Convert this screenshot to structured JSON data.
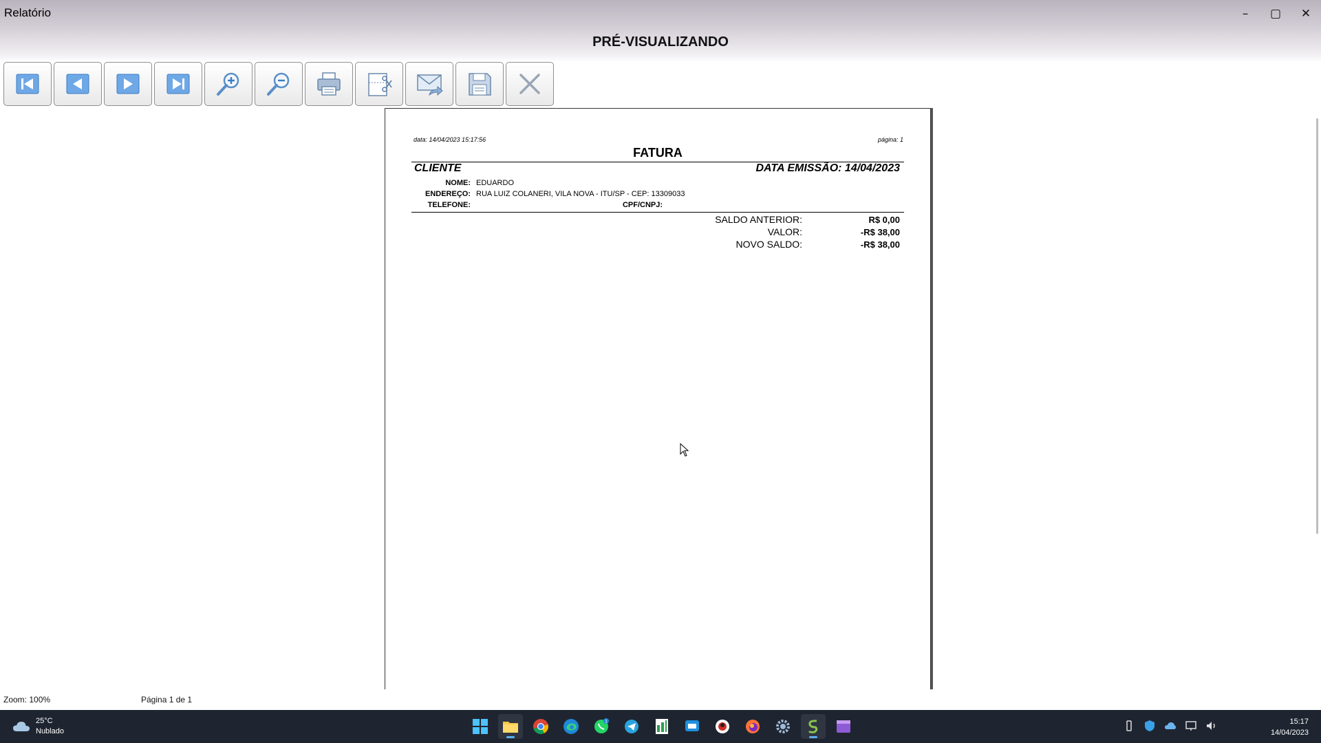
{
  "window": {
    "title": "Relatório",
    "heading": "PRÉ-VISUALIZANDO",
    "controls": {
      "minimize": "–",
      "maximize": "▢",
      "close": "✕"
    }
  },
  "toolbar": {
    "buttons": [
      {
        "name": "first-page",
        "icon": "first-page-icon"
      },
      {
        "name": "previous-page",
        "icon": "previous-page-icon"
      },
      {
        "name": "next-page",
        "icon": "next-page-icon"
      },
      {
        "name": "last-page",
        "icon": "last-page-icon"
      },
      {
        "name": "zoom-in",
        "icon": "zoom-in-icon"
      },
      {
        "name": "zoom-out",
        "icon": "zoom-out-icon"
      },
      {
        "name": "print",
        "icon": "printer-icon"
      },
      {
        "name": "page-setup",
        "icon": "page-setup-icon"
      },
      {
        "name": "email",
        "icon": "email-icon"
      },
      {
        "name": "save",
        "icon": "save-icon"
      },
      {
        "name": "close-preview",
        "icon": "close-icon"
      }
    ]
  },
  "report": {
    "date": "data: 14/04/2023 15:17:56",
    "page": "página: 1",
    "title": "FATURA",
    "cliente_heading": "CLIENTE",
    "emissao": "DATA EMISSÃO: 14/04/2023",
    "fields": {
      "nome_label": "NOME:",
      "nome_value": "EDUARDO",
      "endereco_label": "ENDEREÇO:",
      "endereco_value": "RUA LUIZ COLANERI, VILA NOVA - ITU/SP - CEP: 13309033",
      "telefone_label": "TELEFONE:",
      "cpf_label": "CPF/CNPJ:"
    },
    "summary": {
      "saldo_anterior_label": "SALDO ANTERIOR:",
      "saldo_anterior_value": "R$ 0,00",
      "valor_label": "VALOR:",
      "valor_value": "-R$ 38,00",
      "novo_saldo_label": "NOVO SALDO:",
      "novo_saldo_value": "-R$ 38,00"
    }
  },
  "status": {
    "zoom": "Zoom: 100%",
    "page": "Página 1 de 1"
  },
  "taskbar": {
    "temperature": "25°C",
    "weather": "Nublado",
    "time": "15:17",
    "date": "14/04/2023",
    "apps": [
      "windows-start-icon",
      "file-explorer-icon",
      "chrome-icon",
      "edge-icon",
      "whatsapp-icon",
      "telegram-icon",
      "spreadsheet-app-icon",
      "remote-app-icon",
      "browser-app-icon",
      "firefox-icon",
      "settings-icon",
      "report-app-icon",
      "media-app-icon"
    ],
    "whatsapp_badge": "1"
  },
  "colors": {
    "toolbar_icon_blue": "#4a90d9",
    "toolbar_icon_gray": "#8a9bb0",
    "taskbar_bg": "#1f2530"
  }
}
